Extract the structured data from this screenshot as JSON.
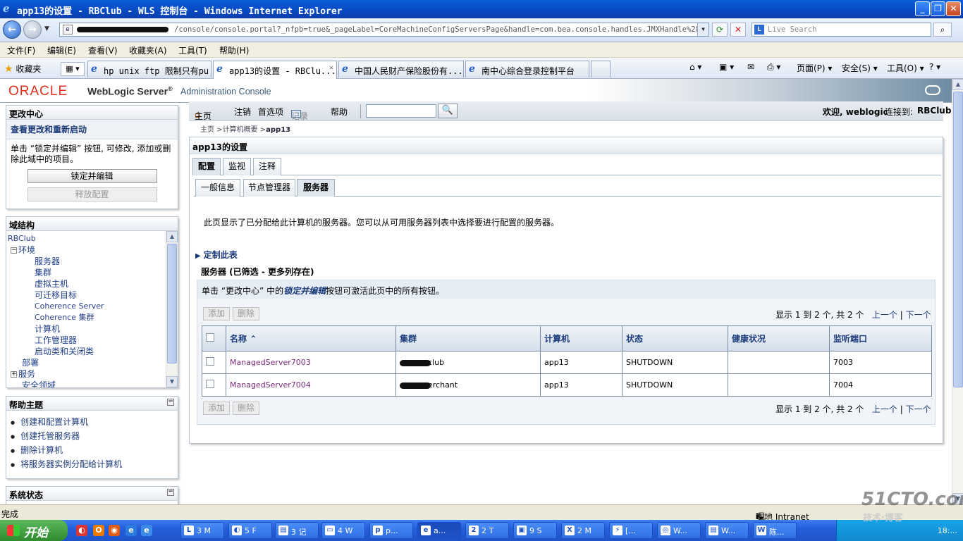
{
  "window": {
    "title": "app13的设置 - RBClub - WLS 控制台 - Windows Internet Explorer",
    "minimize": "_",
    "maximize": "❐",
    "close": "✕"
  },
  "address": {
    "url": "/console/console.portal?_nfpb=true&_pageLabel=CoreMachineConfigServersPage&handle=com.bea.console.handles.JMXHandle%28%22com",
    "search_placeholder": "Live Search"
  },
  "menu": [
    "文件(F)",
    "编辑(E)",
    "查看(V)",
    "收藏夹(A)",
    "工具(T)",
    "帮助(H)"
  ],
  "favorites_label": "收藏夹",
  "browser_tabs": [
    {
      "label": "hp unix ftp 限制只有pu...",
      "active": false
    },
    {
      "label": "app13的设置 - RBClu...",
      "active": true
    },
    {
      "label": "中国人民财产保险股份有...",
      "active": false
    },
    {
      "label": "南中心综合登录控制平台",
      "active": false
    }
  ],
  "toolbar_right": {
    "page": "页面(P)",
    "safety": "安全(S)",
    "tools": "工具(O)"
  },
  "wl_header": {
    "oracle": "ORACLE",
    "product": "WebLogic Server",
    "reg": "®",
    "console": "Administration Console"
  },
  "change_center": {
    "title": "更改中心",
    "link": "查看更改和重新启动",
    "text": "单击 “锁定并编辑” 按钮, 可修改, 添加或删除此域中的项目。",
    "lock_button": "锁定并编辑",
    "release_button": "释放配置"
  },
  "domain_structure": {
    "title": "域结构",
    "root": "RBClub",
    "env": "环境",
    "items": [
      "服务器",
      "集群",
      "虚拟主机",
      "可迁移目标",
      "Coherence Server",
      "Coherence 集群",
      "计算机",
      "工作管理器",
      "启动类和关闭类"
    ],
    "deploy": "部署",
    "services": "服务",
    "security": "安全领域"
  },
  "help_topics": {
    "title": "帮助主题",
    "items": [
      "创建和配置计算机",
      "创建托管服务器",
      "删除计算机",
      "将服务器实例分配给计算机"
    ]
  },
  "system_status": {
    "title": "系统状态"
  },
  "topnav": {
    "home": "主页",
    "logout": "注销",
    "prefs": "首选项",
    "record": "记录",
    "help": "帮助",
    "welcome": "欢迎, weblogic",
    "connected_label": "连接到:",
    "connected_to": "RBClub"
  },
  "breadcrumb": {
    "home": "主页",
    "machines": "计算机概要",
    "current": "app13"
  },
  "main": {
    "title": "app13的设置",
    "tabs": [
      "配置",
      "监视",
      "注释"
    ],
    "subtabs": [
      "一般信息",
      "节点管理器",
      "服务器"
    ],
    "description": "此页显示了已分配给此计算机的服务器。您可以从可用服务器列表中选择要进行配置的服务器。",
    "customize": "定制此表",
    "table_title": "服务器 (已筛选 - 更多列存在)",
    "note_prefix": "单击 “更改中心” 中的",
    "note_link": "锁定并编辑",
    "note_suffix": "按钮可激活此页中的所有按钮。",
    "add_button": "添加",
    "delete_button": "删除",
    "pager": {
      "showing": "显示 1 到 2 个, 共 2 个",
      "prev": "上一个",
      "next": "下一个"
    },
    "columns": [
      "名称",
      "集群",
      "计算机",
      "状态",
      "健康状况",
      "监听端口"
    ],
    "rows": [
      {
        "name": "ManagedServer7003",
        "cluster": "club",
        "machine": "app13",
        "state": "SHUTDOWN",
        "health": "",
        "port": "7003"
      },
      {
        "name": "ManagedServer7004",
        "cluster": "erchant",
        "machine": "app13",
        "state": "SHUTDOWN",
        "health": "",
        "port": "7004"
      }
    ]
  },
  "status": {
    "done": "完成",
    "zone": "本地 Intranet"
  },
  "taskbar": {
    "start": "开始",
    "items": [
      "3 M",
      "5 F",
      "3 记",
      "4 W",
      "p...",
      "a...",
      "2 T",
      "9 S",
      "2 M",
      "[...",
      "W...",
      "W...",
      "陈..."
    ],
    "clock": "18:..."
  },
  "watermark": {
    "site": "51CTO.com",
    "sub": "技术·博客"
  }
}
